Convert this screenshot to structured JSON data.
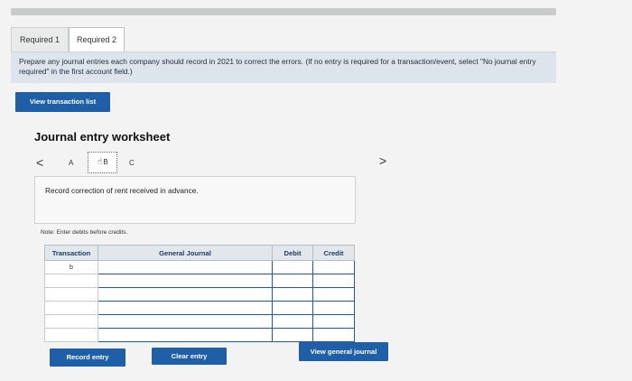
{
  "tabs": [
    {
      "label": "Required 1"
    },
    {
      "label": "Required 2"
    }
  ],
  "instruction": {
    "main": "Prepare any journal entries each company should record in 2021 to correct the errors.",
    "paren": "(If no entry is required for a transaction/event, select \"No journal entry required\" in the first account field.)"
  },
  "buttons": {
    "view_transaction_list": "View transaction list",
    "record_entry": "Record entry",
    "clear_entry": "Clear entry",
    "view_general_journal": "View general journal"
  },
  "worksheet": {
    "title": "Journal entry worksheet",
    "steps": [
      "A",
      "B",
      "C"
    ],
    "description": "Record correction of rent received in advance.",
    "note": "Note: Enter debits before credits."
  },
  "journal_table": {
    "headers": [
      "Transaction",
      "General Journal",
      "Debit",
      "Credit"
    ],
    "rows": [
      {
        "transaction": "b",
        "account": "",
        "debit": "",
        "credit": ""
      },
      {
        "transaction": "",
        "account": "",
        "debit": "",
        "credit": ""
      },
      {
        "transaction": "",
        "account": "",
        "debit": "",
        "credit": ""
      },
      {
        "transaction": "",
        "account": "",
        "debit": "",
        "credit": ""
      },
      {
        "transaction": "",
        "account": "",
        "debit": "",
        "credit": ""
      },
      {
        "transaction": "",
        "account": "",
        "debit": "",
        "credit": ""
      }
    ]
  },
  "colors": {
    "primary_button": "#1f5fa8",
    "instruction_bg": "#dde4ec",
    "input_border": "#2357a0"
  }
}
